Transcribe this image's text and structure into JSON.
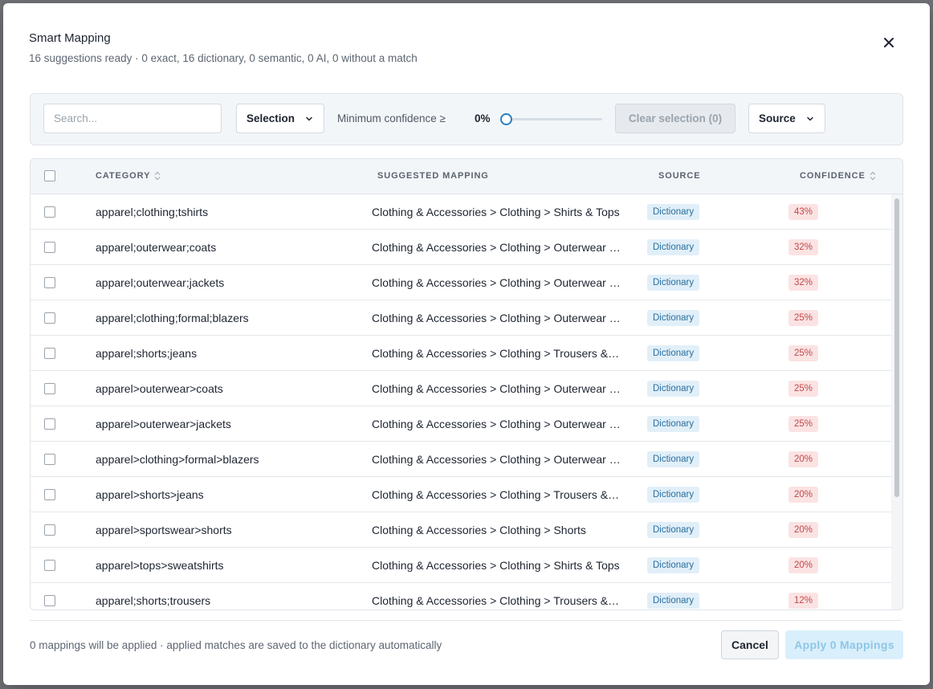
{
  "modal": {
    "title": "Smart Mapping",
    "subtitle": "16 suggestions ready · 0 exact, 16 dictionary, 0 semantic, 0 AI, 0 without a match",
    "close_icon": "close-icon"
  },
  "toolbar": {
    "search_placeholder": "Search...",
    "search_value": "",
    "selection_label": "Selection",
    "min_confidence_label": "Minimum confidence ≥",
    "min_confidence_value": "0%",
    "min_confidence_fraction": 0,
    "clear_selection_label": "Clear selection (0)",
    "source_label": "Source"
  },
  "table": {
    "columns": {
      "category": "CATEGORY",
      "suggested_mapping": "SUGGESTED MAPPING",
      "source": "SOURCE",
      "confidence": "CONFIDENCE"
    },
    "rows": [
      {
        "category": "apparel;clothing;tshirts",
        "mapping": "Clothing & Accessories > Clothing > Shirts & Tops",
        "source": "Dictionary",
        "confidence": "43%"
      },
      {
        "category": "apparel;outerwear;coats",
        "mapping": "Clothing & Accessories > Clothing > Outerwear > Coats & Jackets",
        "source": "Dictionary",
        "confidence": "32%"
      },
      {
        "category": "apparel;outerwear;jackets",
        "mapping": "Clothing & Accessories > Clothing > Outerwear > Coats & Jackets",
        "source": "Dictionary",
        "confidence": "32%"
      },
      {
        "category": "apparel;clothing;formal;blazers",
        "mapping": "Clothing & Accessories > Clothing > Outerwear > Coats & Jackets",
        "source": "Dictionary",
        "confidence": "25%"
      },
      {
        "category": "apparel;shorts;jeans",
        "mapping": "Clothing & Accessories > Clothing > Trousers & Jeans",
        "source": "Dictionary",
        "confidence": "25%"
      },
      {
        "category": "apparel>outerwear>coats",
        "mapping": "Clothing & Accessories > Clothing > Outerwear > Coats & Jackets",
        "source": "Dictionary",
        "confidence": "25%"
      },
      {
        "category": "apparel>outerwear>jackets",
        "mapping": "Clothing & Accessories > Clothing > Outerwear > Coats & Jackets",
        "source": "Dictionary",
        "confidence": "25%"
      },
      {
        "category": "apparel>clothing>formal>blazers",
        "mapping": "Clothing & Accessories > Clothing > Outerwear > Coats & Jackets",
        "source": "Dictionary",
        "confidence": "20%"
      },
      {
        "category": "apparel>shorts>jeans",
        "mapping": "Clothing & Accessories > Clothing > Trousers & Jeans",
        "source": "Dictionary",
        "confidence": "20%"
      },
      {
        "category": "apparel>sportswear>shorts",
        "mapping": "Clothing & Accessories > Clothing > Shorts",
        "source": "Dictionary",
        "confidence": "20%"
      },
      {
        "category": "apparel>tops>sweatshirts",
        "mapping": "Clothing & Accessories > Clothing > Shirts & Tops",
        "source": "Dictionary",
        "confidence": "20%"
      },
      {
        "category": "apparel;shorts;trousers",
        "mapping": "Clothing & Accessories > Clothing > Trousers & Jeans",
        "source": "Dictionary",
        "confidence": "12%"
      }
    ]
  },
  "footer": {
    "info": "0 mappings will be applied · applied matches are saved to the dictionary automatically",
    "cancel_label": "Cancel",
    "apply_label": "Apply 0 Mappings"
  },
  "colors": {
    "accent": "#2a7fc2",
    "source_badge_bg": "#e1eff8",
    "source_badge_text": "#2a6f9f",
    "confidence_badge_bg": "#fbe3e3",
    "confidence_badge_text": "#c2474a"
  }
}
